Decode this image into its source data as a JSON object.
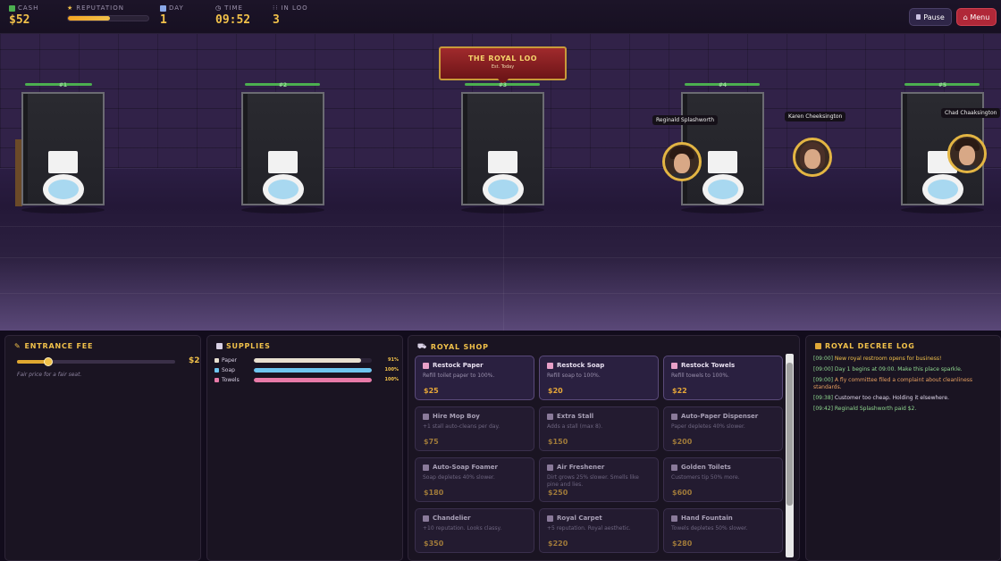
{
  "hud": {
    "cash_label": "CASH",
    "cash": "$52",
    "reputation_label": "REPUTATION",
    "reputation_fraction": 0.52,
    "day_label": "DAY",
    "day": "1",
    "time_label": "TIME",
    "time": "09:52",
    "in_loo_label": "IN LOO",
    "in_loo": "3",
    "pause_label": "Pause",
    "menu_label": "⌂ Menu"
  },
  "scene": {
    "banner_title": "THE ROYAL LOO",
    "banner_sub": "Est. Today",
    "stalls": [
      {
        "label": "#1",
        "condition": 0.85
      },
      {
        "label": "#2",
        "condition": 0.95
      },
      {
        "label": "#3",
        "condition": 0.95
      },
      {
        "label": "#4",
        "condition": 0.95
      },
      {
        "label": "#5",
        "condition": 0.95
      }
    ],
    "customers": [
      "Reginald Splashworth",
      "Karen Cheeksington",
      "Chad Chaaksington"
    ]
  },
  "fee": {
    "title": "ENTRANCE FEE",
    "value": "$2",
    "slider_fraction": 0.2,
    "description": "Fair price for a fair seat."
  },
  "supplies": {
    "title": "SUPPLIES",
    "items": [
      {
        "name": "Paper",
        "pct_label": "91%",
        "fraction": 0.91,
        "color": "#e8e0d0"
      },
      {
        "name": "Soap",
        "pct_label": "100%",
        "fraction": 1.0,
        "color": "#6ec6f0"
      },
      {
        "name": "Towels",
        "pct_label": "100%",
        "fraction": 1.0,
        "color": "#e87aa8"
      }
    ]
  },
  "shop": {
    "title": "ROYAL SHOP",
    "items": [
      {
        "title": "Restock Paper",
        "desc": "Refill toilet paper to 100%.",
        "price": "$25",
        "icon": "paper-roll-icon",
        "active": true
      },
      {
        "title": "Restock Soap",
        "desc": "Refill soap to 100%.",
        "price": "$20",
        "icon": "soap-icon",
        "active": true
      },
      {
        "title": "Restock Towels",
        "desc": "Refill towels to 100%.",
        "price": "$22",
        "icon": "towel-icon",
        "active": true
      },
      {
        "title": "Hire Mop Boy",
        "desc": "+1 stall auto-cleans per day.",
        "price": "$75",
        "icon": "mop-icon",
        "active": false
      },
      {
        "title": "Extra Stall",
        "desc": "Adds a stall (max 8).",
        "price": "$150",
        "icon": "toilet-icon",
        "active": false
      },
      {
        "title": "Auto-Paper Dispenser",
        "desc": "Paper depletes 40% slower.",
        "price": "$200",
        "icon": "dispenser-icon",
        "active": false
      },
      {
        "title": "Auto-Soap Foamer",
        "desc": "Soap depletes 40% slower.",
        "price": "$180",
        "icon": "foamer-icon",
        "active": false
      },
      {
        "title": "Air Freshener",
        "desc": "Dirt grows 25% slower. Smells like pine and lies.",
        "price": "$250",
        "icon": "pine-icon",
        "active": false
      },
      {
        "title": "Golden Toilets",
        "desc": "Customers tip 50% more.",
        "price": "$600",
        "icon": "crown-icon",
        "active": false
      },
      {
        "title": "Chandelier",
        "desc": "+10 reputation. Looks classy.",
        "price": "$350",
        "icon": "bulb-icon",
        "active": false
      },
      {
        "title": "Royal Carpet",
        "desc": "+5 reputation. Royal aesthetic.",
        "price": "$220",
        "icon": "carpet-icon",
        "active": false
      },
      {
        "title": "Hand Fountain",
        "desc": "Towels depletes 50% slower.",
        "price": "$280",
        "icon": "fountain-icon",
        "active": false
      }
    ]
  },
  "log": {
    "title": "ROYAL DECREE LOG",
    "entries": [
      {
        "ts": "[09:00]",
        "text": "New royal restroom opens for business!",
        "tone": "gold"
      },
      {
        "ts": "[09:00]",
        "text": "Day 1 begins at 09:00. Make this place sparkle.",
        "tone": "green"
      },
      {
        "ts": "[09:00]",
        "text": "A fly committee filed a complaint about cleanliness standards.",
        "tone": "orange"
      },
      {
        "ts": "[09:38]",
        "text": "Customer too cheap. Holding it elsewhere.",
        "tone": "white"
      },
      {
        "ts": "[09:42]",
        "text": "Reginald Splashworth paid $2.",
        "tone": "green"
      }
    ]
  },
  "colors": {
    "accent": "#f1c14a",
    "danger": "#b02838",
    "panel": "#1a1422"
  }
}
